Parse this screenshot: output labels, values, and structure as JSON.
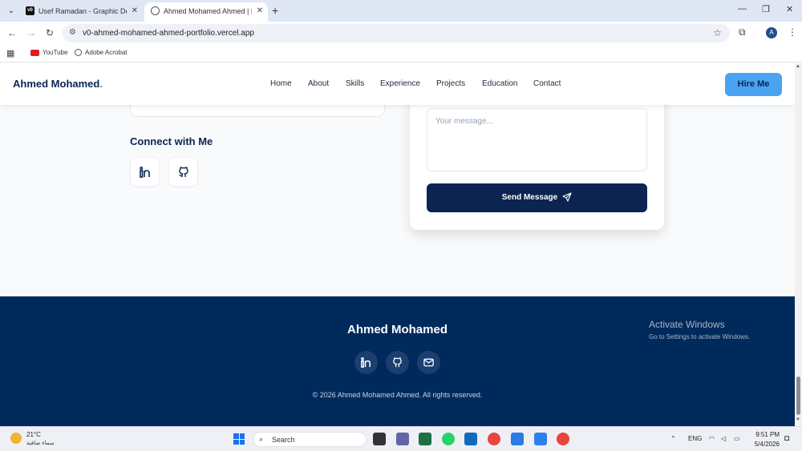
{
  "browser": {
    "tabs": [
      {
        "title": "Usef Ramadan - Graphic Design",
        "favicon": "v0-logo-icon"
      },
      {
        "title": "Ahmed Mohamed Ahmed | Ma",
        "favicon": "globe-icon"
      }
    ],
    "url": "v0-ahmed-mohamed-ahmed-portfolio.vercel.app",
    "profile_initial": "A",
    "bookmarks": [
      {
        "label": "YouTube",
        "icon": "youtube-icon"
      },
      {
        "label": "Adobe Acrobat",
        "icon": "acrobat-icon"
      }
    ]
  },
  "site": {
    "brand": "Ahmed Mohamed",
    "brand_dot": ".",
    "nav": [
      "Home",
      "About",
      "Skills",
      "Experience",
      "Projects",
      "Education",
      "Contact"
    ],
    "hire_label": "Hire Me"
  },
  "contact": {
    "connect_title": "Connect with Me",
    "message_placeholder": "Your message...",
    "send_label": "Send Message",
    "social": [
      "linkedin-icon",
      "github-icon"
    ]
  },
  "footer": {
    "title": "Ahmed Mohamed",
    "icons": [
      "linkedin-icon",
      "github-icon",
      "mail-icon"
    ],
    "copyright": "© 2026 Ahmed Mohamed Ahmed. All rights reserved."
  },
  "watermark": {
    "title": "Activate Windows",
    "subtitle": "Go to Settings to activate Windows."
  },
  "taskbar": {
    "temperature": "21°C",
    "condition": "سماء صافية",
    "search_label": "Search",
    "language": "ENG",
    "time": "9:51 PM",
    "date": "5/4/2026"
  },
  "colors": {
    "navy": "#0b2550",
    "footer": "#002a5c",
    "accent": "#4aa3f0"
  }
}
